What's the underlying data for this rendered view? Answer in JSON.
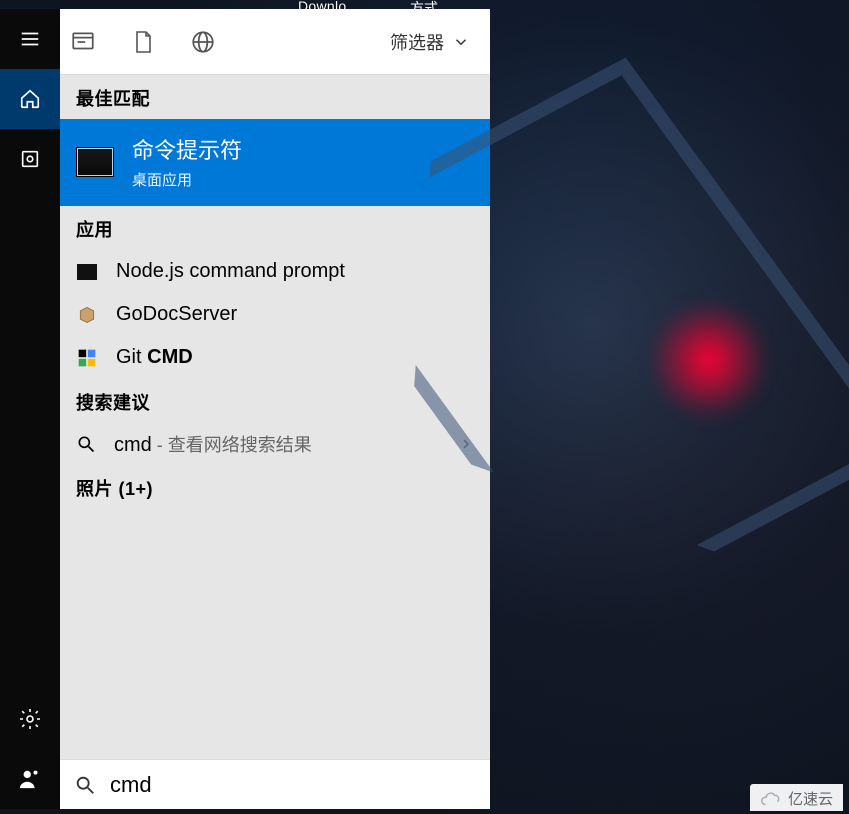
{
  "desktop_fragments": {
    "left": "Downlo...",
    "right": "方式"
  },
  "rail": {
    "items": [
      {
        "name": "hamburger-icon"
      },
      {
        "name": "home-icon",
        "active": true
      },
      {
        "name": "recent-icon"
      }
    ],
    "bottom": [
      {
        "name": "settings-icon"
      },
      {
        "name": "user-icon"
      }
    ]
  },
  "scopes": [
    {
      "name": "apps-scope-icon"
    },
    {
      "name": "documents-scope-icon"
    },
    {
      "name": "web-scope-icon"
    }
  ],
  "filter_label": "筛选器",
  "sections": {
    "best_match": "最佳匹配",
    "apps": "应用",
    "suggestions": "搜索建议",
    "photos": "照片 (1+)"
  },
  "best_match": {
    "title": "命令提示符",
    "subtitle": "桌面应用"
  },
  "apps": [
    {
      "label": "Node.js command prompt",
      "icon": "terminal-icon"
    },
    {
      "label": "GoDocServer",
      "icon": "package-icon"
    },
    {
      "label_prefix": "Git ",
      "label_bold": "CMD",
      "icon": "git-icon"
    }
  ],
  "suggestion": {
    "query": "cmd",
    "aux": " - 查看网络搜索结果"
  },
  "search": {
    "value": "cmd"
  },
  "watermark": "亿速云",
  "colors": {
    "accent": "#0078d7",
    "rail": "#0a0a0a"
  }
}
